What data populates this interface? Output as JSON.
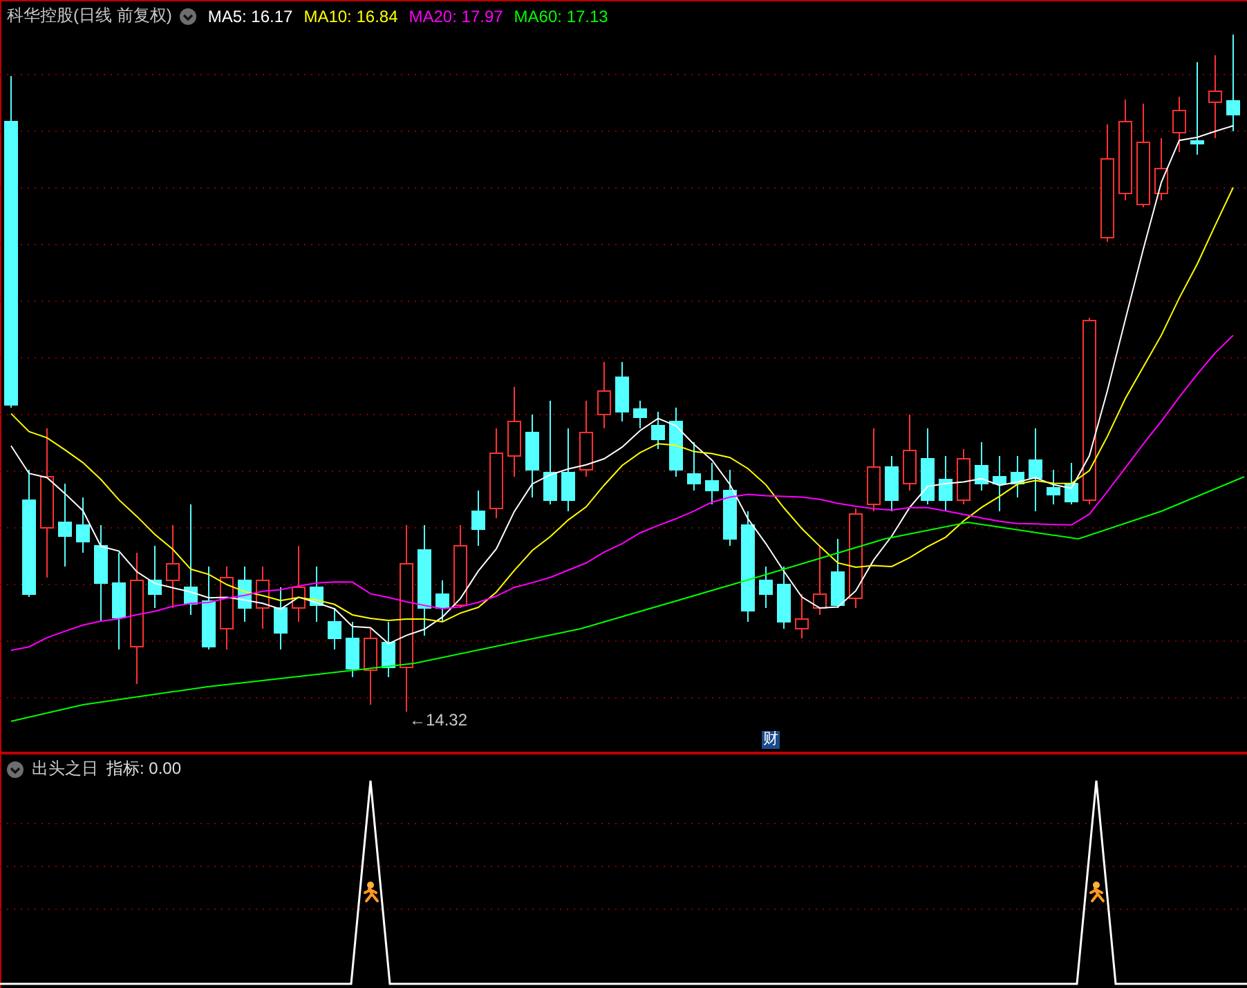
{
  "main_panel": {
    "title": "科华控股(日线 前复权)",
    "moving_averages": [
      {
        "text": "MA5: 16.17",
        "color": "#ffffff"
      },
      {
        "text": "MA10: 16.84",
        "color": "#ffff00"
      },
      {
        "text": "MA20: 17.97",
        "color": "#ff00ff"
      },
      {
        "text": "MA60: 17.13",
        "color": "#00ff00"
      }
    ],
    "low_marker": "←14.32",
    "finance_badge": "财"
  },
  "indicator_panel": {
    "name": "出头之日",
    "reading": "指标: 0.00"
  }
}
